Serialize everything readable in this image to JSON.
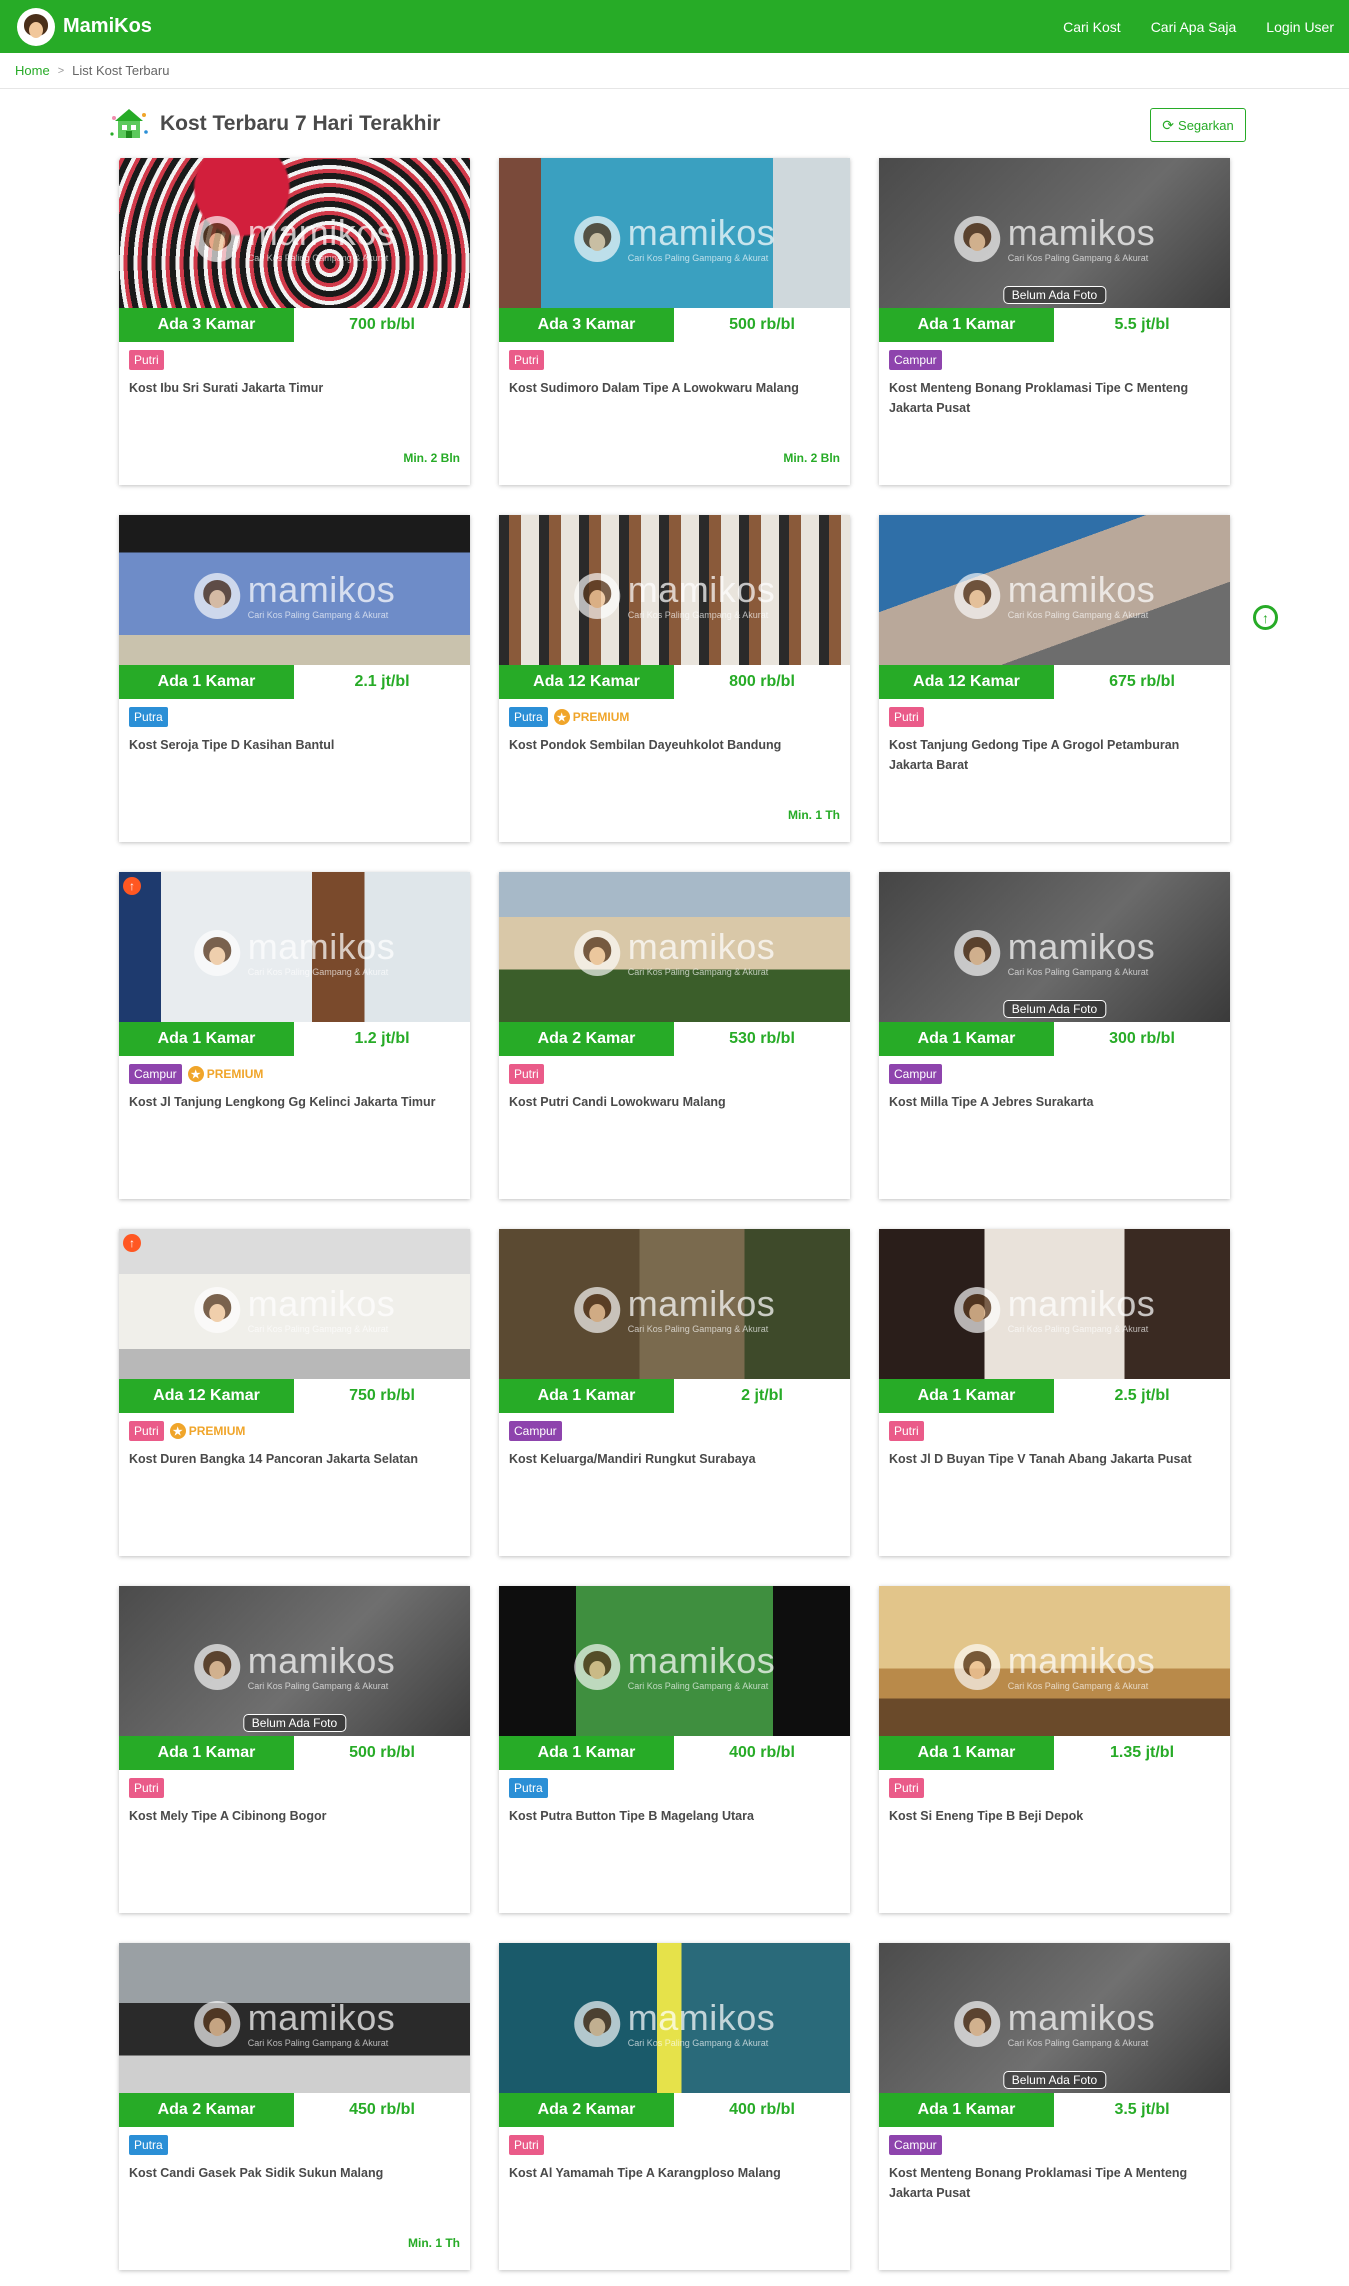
{
  "brand": {
    "name": "MamiKos"
  },
  "nav": {
    "items": [
      "Cari Kost",
      "Cari Apa Saja",
      "Login User"
    ]
  },
  "breadcrumb": {
    "home": "Home",
    "separator": ">",
    "current": "List Kost Terbaru"
  },
  "section": {
    "title": "Kost Terbaru 7 Hari Terakhir",
    "refresh_label": "Segarkan"
  },
  "colors": {
    "brand_green": "#27ab27",
    "putri": "#ea5b89",
    "putra": "#2b8fd6",
    "campur": "#8e44ad",
    "premium": "#f0a52a"
  },
  "watermark": {
    "text": "mamikos",
    "tagline": "Cari Kos Paling Gampang & Akurat"
  },
  "listings": [
    {
      "available": "Ada 3 Kamar",
      "price": "700 rb/bl",
      "gender": "Putri",
      "premium": "",
      "name": "Kost Ibu Sri Surati Jakarta Timur",
      "min_stay": "Min. 2 Bln",
      "photo_note": "",
      "promo": false
    },
    {
      "available": "Ada 3 Kamar",
      "price": "500 rb/bl",
      "gender": "Putri",
      "premium": "",
      "name": "Kost Sudimoro Dalam Tipe A Lowokwaru Malang",
      "min_stay": "Min. 2 Bln",
      "photo_note": "",
      "promo": false
    },
    {
      "available": "Ada 1 Kamar",
      "price": "5.5 jt/bl",
      "gender": "Campur",
      "premium": "",
      "name": "Kost Menteng Bonang Proklamasi Tipe C Menteng Jakarta Pusat",
      "min_stay": "",
      "photo_note": "Belum Ada Foto",
      "promo": false
    },
    {
      "available": "Ada 1 Kamar",
      "price": "2.1 jt/bl",
      "gender": "Putra",
      "premium": "",
      "name": "Kost Seroja Tipe D Kasihan Bantul",
      "min_stay": "",
      "photo_note": "",
      "promo": false
    },
    {
      "available": "Ada 12 Kamar",
      "price": "800 rb/bl",
      "gender": "Putra",
      "premium": "PREMIUM",
      "name": "Kost Pondok Sembilan Dayeuhkolot Bandung",
      "min_stay": "Min. 1 Th",
      "photo_note": "",
      "promo": false
    },
    {
      "available": "Ada 12 Kamar",
      "price": "675 rb/bl",
      "gender": "Putri",
      "premium": "",
      "name": "Kost Tanjung Gedong Tipe A Grogol Petamburan Jakarta Barat",
      "min_stay": "",
      "photo_note": "",
      "promo": false
    },
    {
      "available": "Ada 1 Kamar",
      "price": "1.2 jt/bl",
      "gender": "Campur",
      "premium": "PREMIUM",
      "name": "Kost Jl Tanjung Lengkong Gg Kelinci Jakarta Timur",
      "min_stay": "",
      "photo_note": "",
      "promo": true
    },
    {
      "available": "Ada 2 Kamar",
      "price": "530 rb/bl",
      "gender": "Putri",
      "premium": "",
      "name": "Kost Putri Candi Lowokwaru Malang",
      "min_stay": "",
      "photo_note": "",
      "promo": false
    },
    {
      "available": "Ada 1 Kamar",
      "price": "300 rb/bl",
      "gender": "Campur",
      "premium": "",
      "name": "Kost Milla Tipe A Jebres Surakarta",
      "min_stay": "",
      "photo_note": "Belum Ada Foto",
      "promo": false
    },
    {
      "available": "Ada 12 Kamar",
      "price": "750 rb/bl",
      "gender": "Putri",
      "premium": "PREMIUM",
      "name": "Kost Duren Bangka 14 Pancoran Jakarta Selatan",
      "min_stay": "",
      "photo_note": "",
      "promo": true
    },
    {
      "available": "Ada 1 Kamar",
      "price": "2 jt/bl",
      "gender": "Campur",
      "premium": "",
      "name": "Kost Keluarga/Mandiri Rungkut Surabaya",
      "min_stay": "",
      "photo_note": "",
      "promo": false
    },
    {
      "available": "Ada 1 Kamar",
      "price": "2.5 jt/bl",
      "gender": "Putri",
      "premium": "",
      "name": "Kost Jl D Buyan Tipe V Tanah Abang Jakarta Pusat",
      "min_stay": "",
      "photo_note": "",
      "promo": false
    },
    {
      "available": "Ada 1 Kamar",
      "price": "500 rb/bl",
      "gender": "Putri",
      "premium": "",
      "name": "Kost Mely Tipe A Cibinong Bogor",
      "min_stay": "",
      "photo_note": "Belum Ada Foto",
      "promo": false
    },
    {
      "available": "Ada 1 Kamar",
      "price": "400 rb/bl",
      "gender": "Putra",
      "premium": "",
      "name": "Kost Putra Button Tipe B Magelang Utara",
      "min_stay": "",
      "photo_note": "",
      "promo": false
    },
    {
      "available": "Ada 1 Kamar",
      "price": "1.35 jt/bl",
      "gender": "Putri",
      "premium": "",
      "name": "Kost Si Eneng Tipe B Beji Depok",
      "min_stay": "",
      "photo_note": "",
      "promo": false
    },
    {
      "available": "Ada 2 Kamar",
      "price": "450 rb/bl",
      "gender": "Putra",
      "premium": "",
      "name": "Kost Candi Gasek Pak Sidik Sukun Malang",
      "min_stay": "Min. 1 Th",
      "photo_note": "",
      "promo": false
    },
    {
      "available": "Ada 2 Kamar",
      "price": "400 rb/bl",
      "gender": "Putri",
      "premium": "",
      "name": "Kost Al Yamamah Tipe A Karangploso Malang",
      "min_stay": "",
      "photo_note": "",
      "promo": false
    },
    {
      "available": "Ada 1 Kamar",
      "price": "3.5 jt/bl",
      "gender": "Campur",
      "premium": "",
      "name": "Kost Menteng Bonang Proklamasi Tipe A Menteng Jakarta Pusat",
      "min_stay": "",
      "photo_note": "Belum Ada Foto",
      "promo": false
    }
  ]
}
